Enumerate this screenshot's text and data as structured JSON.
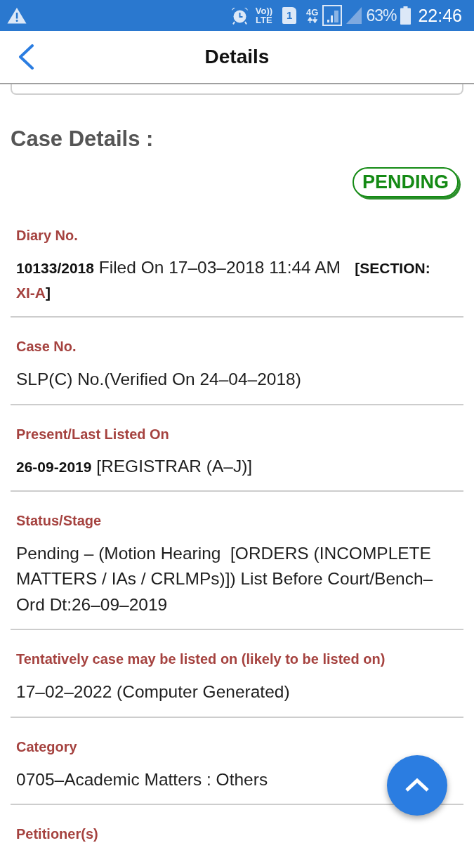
{
  "status_bar": {
    "volte": [
      "Vo))",
      "LTE"
    ],
    "sim_slot": "1",
    "network": "4G",
    "battery": "63%",
    "time": "22:46"
  },
  "header": {
    "title": "Details"
  },
  "section_title": "Case Details :",
  "status_badge": {
    "label": "PENDING"
  },
  "fields": [
    {
      "label": "Diary No.",
      "parts": [
        {
          "kind": "strong",
          "text": "10133/2018"
        },
        {
          "kind": "plain",
          "text": " Filed On 17–03–2018 11:44 AM   "
        },
        {
          "kind": "strong",
          "text": "[SECTION: "
        },
        {
          "kind": "accent",
          "text": "XI-A"
        },
        {
          "kind": "strong",
          "text": "]"
        }
      ]
    },
    {
      "label": "Case No.",
      "value": "SLP(C) No.(Verified On 24–04–2018)"
    },
    {
      "label": "Present/Last Listed On",
      "parts": [
        {
          "kind": "strong",
          "text": "26-09-2019"
        },
        {
          "kind": "plain",
          "text": " [REGISTRAR (A–J)]"
        }
      ]
    },
    {
      "label": "Status/Stage",
      "value": "Pending – (Motion Hearing  [ORDERS (INCOMPLETE MATTERS / IAs / CRLMPs)]) List Before Court/Bench–Ord Dt:26–09–2019"
    },
    {
      "label": "Tentatively case may be listed on (likely to be listed on)",
      "value": "17–02–2022 (Computer Generated)"
    },
    {
      "label": "Category",
      "value": "0705–Academic Matters : Others"
    },
    {
      "label": "Petitioner(s)"
    }
  ]
}
